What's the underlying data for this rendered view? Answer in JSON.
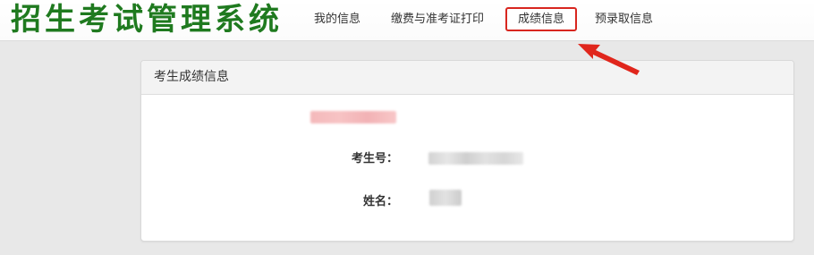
{
  "header": {
    "logo_text": "招生考试管理系统"
  },
  "nav": {
    "items": [
      {
        "label": "我的信息"
      },
      {
        "label": "缴费与准考证打印"
      },
      {
        "label": "成绩信息"
      },
      {
        "label": "预录取信息"
      }
    ],
    "active_index": 2
  },
  "panel": {
    "title": "考生成绩信息",
    "fields": [
      {
        "label": "考生号："
      },
      {
        "label": "姓名："
      }
    ]
  },
  "colors": {
    "logo_green": "#1f7a1f",
    "highlight_red": "#d8261f",
    "arrow_red": "#e0261c"
  }
}
